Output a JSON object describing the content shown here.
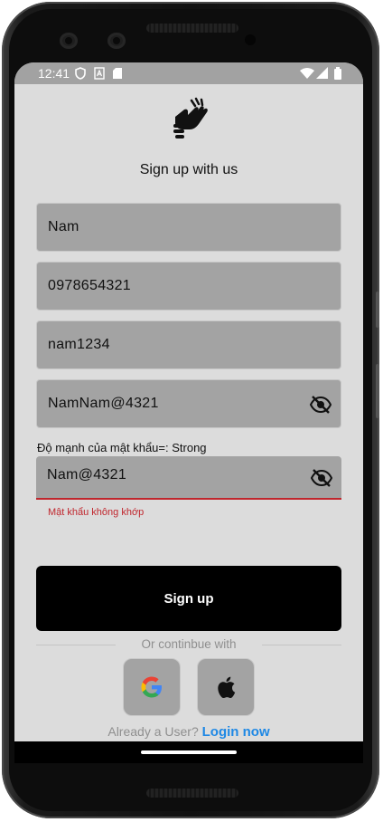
{
  "status_bar": {
    "time": "12:41"
  },
  "header": {
    "title": "Sign up with us"
  },
  "form": {
    "name_value": "Nam",
    "phone_value": "0978654321",
    "username_value": "nam1234",
    "password_value": "NamNam@4321",
    "strength_text": "Độ mạnh của mật khẩu=: Strong",
    "confirm_value": "Nam@4321",
    "confirm_error": "Mật khẩu không khớp"
  },
  "actions": {
    "signup_label": "Sign up",
    "divider_text": "Or continbue with",
    "login_prompt": "Already a User?",
    "login_link": "Login now"
  },
  "icons": {
    "logo": "sign-language-hands-icon",
    "eye": "eye-slash-icon",
    "google": "google-icon",
    "apple": "apple-icon"
  },
  "colors": {
    "error": "#c0262d",
    "link": "#1e88e5",
    "button": "#000000",
    "field_bg": "#a3a3a3",
    "screen_bg": "#dcdcdc"
  }
}
